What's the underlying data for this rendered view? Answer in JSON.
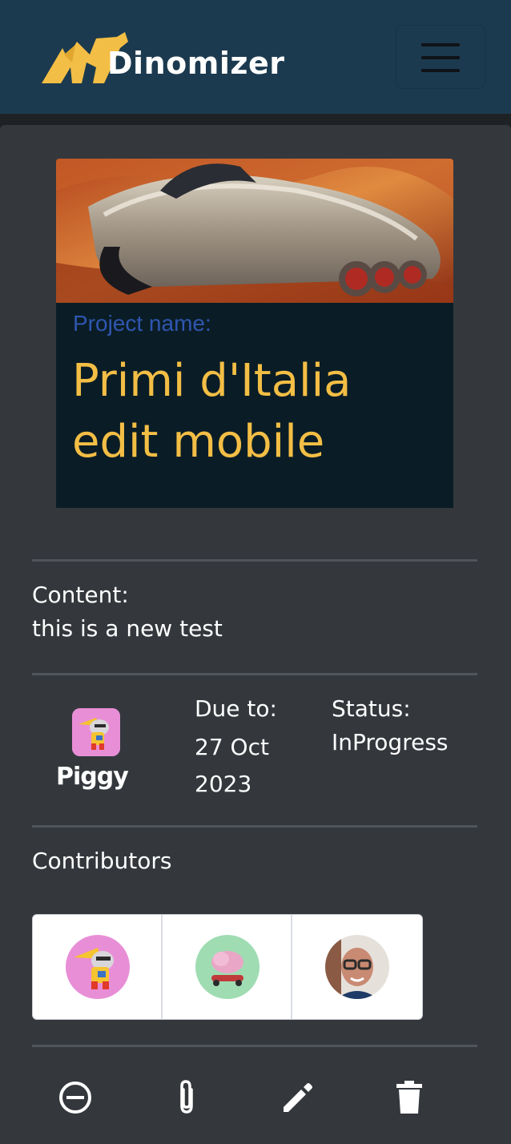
{
  "header": {
    "brand_name": "Dinomizer",
    "logo_icon": "dinosaur-logo-icon",
    "menu_icon": "hamburger-menu-icon",
    "brand_color": "#f3be45",
    "background_color": "#1c3a4f"
  },
  "project": {
    "image_description": "classic-car-photo",
    "name_label": "Project name:",
    "name": "Primi d'Italia edit mobile",
    "name_color": "#f3be45"
  },
  "content": {
    "label": "Content:",
    "value": "this is a new test"
  },
  "owner": {
    "name": "Piggy",
    "avatar_icon": "superhero-pig-avatar"
  },
  "due": {
    "label": "Due to:",
    "value": "27 Oct 2023"
  },
  "status": {
    "label": "Status:",
    "value": "InProgress"
  },
  "contributors": {
    "label": "Contributors",
    "items": [
      {
        "avatar_icon": "superhero-pig-avatar"
      },
      {
        "avatar_icon": "pink-cloud-skateboard-avatar"
      },
      {
        "avatar_icon": "old-man-glasses-avatar"
      }
    ]
  },
  "actions": [
    {
      "icon": "minus-circle-icon"
    },
    {
      "icon": "paperclip-icon"
    },
    {
      "icon": "pencil-icon"
    },
    {
      "icon": "trash-icon"
    }
  ]
}
